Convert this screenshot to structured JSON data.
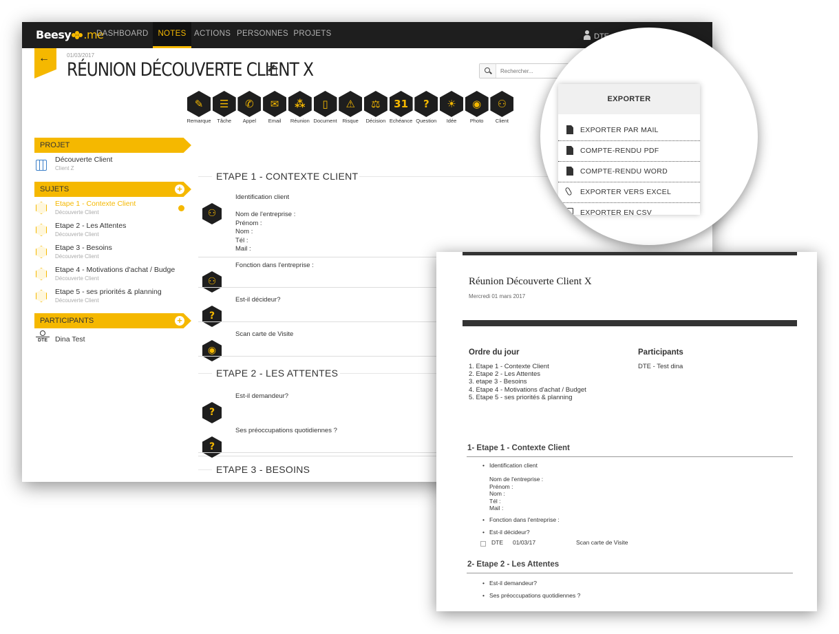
{
  "app": {
    "logo_main": "Beesy",
    "logo_suffix": ".me",
    "nav": [
      "DASHBOARD",
      "NOTES",
      "ACTIONS",
      "PERSONNES",
      "PROJETS"
    ],
    "active_nav": "NOTES",
    "user": "DTE",
    "brand_color": "#f5b800",
    "accent_blue": "#3a7fc8"
  },
  "header": {
    "date": "01/03/2017",
    "title": "RÉUNION DÉCOUVERTE CLIENT X",
    "search_placeholder": "Rechercher..."
  },
  "note_types": [
    {
      "label": "Remarque",
      "icon": "pen-icon",
      "glyph": "✎"
    },
    {
      "label": "Tâche",
      "icon": "checklist-icon",
      "glyph": "☰"
    },
    {
      "label": "Appel",
      "icon": "phone-icon",
      "glyph": "✆"
    },
    {
      "label": "Email",
      "icon": "envelope-icon",
      "glyph": "✉"
    },
    {
      "label": "Réunion",
      "icon": "meeting-icon",
      "glyph": "⁂"
    },
    {
      "label": "Document",
      "icon": "document-icon",
      "glyph": "▯"
    },
    {
      "label": "Risque",
      "icon": "warning-icon",
      "glyph": "⚠"
    },
    {
      "label": "Décision",
      "icon": "gavel-icon",
      "glyph": "⚖"
    },
    {
      "label": "Echéance",
      "icon": "calendar-icon",
      "glyph": "31"
    },
    {
      "label": "Question",
      "icon": "question-icon",
      "glyph": "?"
    },
    {
      "label": "Idée",
      "icon": "lightbulb-icon",
      "glyph": "☀"
    },
    {
      "label": "Photo",
      "icon": "camera-icon",
      "glyph": "◉"
    },
    {
      "label": "Client",
      "icon": "client-icon",
      "glyph": "⚇"
    }
  ],
  "sidebar": {
    "projet_label": "PROJET",
    "projet": {
      "name": "Découverte Client",
      "sub": "Client Z"
    },
    "sujets_label": "SUJETS",
    "sujets": [
      {
        "name": "Etape 1 - Contexte Client",
        "sub": "Découverte Client"
      },
      {
        "name": "Etape 2 - Les Attentes",
        "sub": "Découverte Client"
      },
      {
        "name": "Etape 3 - Besoins",
        "sub": "Découverte Client"
      },
      {
        "name": "Etape 4 - Motivations d'achat / Budge",
        "sub": "Découverte Client"
      },
      {
        "name": "Etape 5 - ses priorités & planning",
        "sub": "Découverte Client"
      }
    ],
    "participants_label": "PARTICIPANTS",
    "participant": {
      "badge": "DTE",
      "name": "Dina Test"
    }
  },
  "content": {
    "step1_title": "ETAPE 1 - CONTEXTE CLIENT",
    "step1_items": [
      {
        "text": "Identification client\n\nNom de l'entreprise :\nPrénom :\nNom :\nTél :\nMail :",
        "icon": "client-icon",
        "glyph": "⚇"
      },
      {
        "text": "Fonction dans l'entreprise :",
        "icon": "client-icon",
        "glyph": "⚇"
      },
      {
        "text": "Est-il décideur?",
        "icon": "question-icon",
        "glyph": "?"
      },
      {
        "text": "Scan carte de Visite",
        "icon": "camera-icon",
        "glyph": "◉"
      }
    ],
    "step2_title": "ETAPE 2 - LES ATTENTES",
    "step2_items": [
      {
        "text": "Est-il demandeur?",
        "icon": "question-icon",
        "glyph": "?"
      },
      {
        "text": "Ses préoccupations quotidiennes ?",
        "icon": "question-icon",
        "glyph": "?"
      }
    ],
    "step3_title": "ETAPE 3 - BESOINS"
  },
  "export_menu": {
    "title": "EXPORTER",
    "items": [
      "EXPORTER PAR MAIL",
      "COMPTE-RENDU PDF",
      "COMPTE-RENDU WORD",
      "EXPORTER VERS EXCEL",
      "EXPORTER EN CSV"
    ]
  },
  "pdf": {
    "title": "Réunion Découverte Client X",
    "date": "Mercredi 01 mars 2017",
    "agenda_title": "Ordre du jour",
    "agenda": [
      "1. Etape 1 - Contexte Client",
      "2. Etape 2 - Les Attentes",
      "3. etape 3 - Besoins",
      "4. Etape 4 - Motivations d'achat / Budget",
      "5. Etape 5 - ses priorités & planning"
    ],
    "participants_title": "Participants",
    "participants": "DTE - Test dina",
    "section1": "1- Etape 1 - Contexte Client",
    "s1_b1": "Identification client",
    "s1_sub": "Nom de l'entreprise :\nPrénom :\nNom :\nTél :\nMail :",
    "s1_b2": "Fonction dans l'entreprise :",
    "s1_b3": "Est-il décideur?",
    "s1_row": {
      "who": "DTE",
      "date": "01/03/17",
      "text": "Scan carte de Visite"
    },
    "section2": "2- Etape 2 - Les Attentes",
    "s2_b1": "Est-il demandeur?",
    "s2_b2": "Ses préoccupations quotidiennes ?"
  }
}
